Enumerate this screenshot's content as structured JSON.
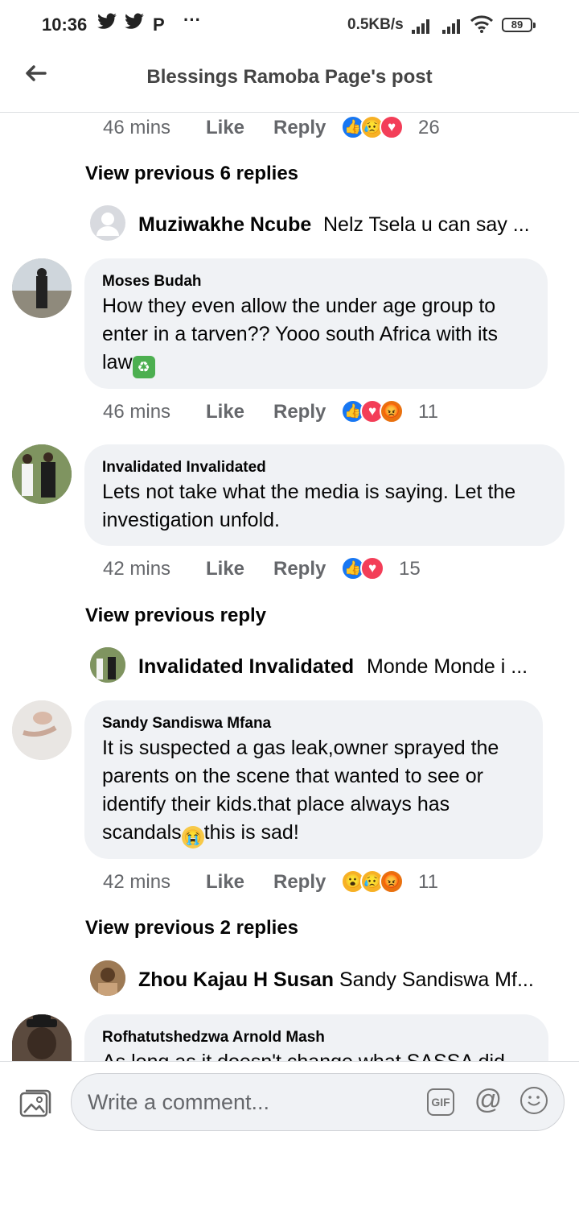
{
  "status_bar": {
    "time": "10:36",
    "icons": [
      "twitter-icon",
      "twitter-icon",
      "p-icon",
      "more-icon"
    ],
    "network_speed": "0.5KB/s",
    "battery": "89"
  },
  "header": {
    "title": "Blessings Ramoba Page's post",
    "back_icon": "arrow-left-icon"
  },
  "top_meta": {
    "time": "46 mins",
    "like": "Like",
    "reply": "Reply",
    "reactions": [
      "like",
      "sad",
      "love"
    ],
    "count": "26"
  },
  "threads": [
    {
      "view_previous": "View previous 6 replies",
      "mini_reply": {
        "name": "Muziwakhe Ncube",
        "text": "Nelz Tsela u can say ..."
      }
    },
    {
      "view_previous": "View previous reply",
      "mini_reply": {
        "name": "Invalidated Invalidated",
        "text": "Monde Monde i ..."
      }
    },
    {
      "view_previous": "View previous 2 replies",
      "mini_reply": {
        "name": "Zhou Kajau H Susan",
        "text": "Sandy Sandiswa Mf..."
      }
    }
  ],
  "comments": [
    {
      "author": "Moses Budah",
      "line1": "How they even allow the under age group to",
      "line2": "enter in a tarven?? Yooo south Africa with its",
      "line3": "law",
      "emoji": "trash-bin-emoji",
      "time": "46 mins",
      "like": "Like",
      "reply": "Reply",
      "reactions": [
        "like",
        "love",
        "angry"
      ],
      "count": "11"
    },
    {
      "author": "Invalidated Invalidated",
      "line1": "Lets not take what the media is saying. Let the",
      "line2": "investigation unfold.",
      "time": "42 mins",
      "like": "Like",
      "reply": "Reply",
      "reactions": [
        "like",
        "love"
      ],
      "count": "15"
    },
    {
      "author": "Sandy Sandiswa Mfana",
      "line1": "It is suspected a gas leak,owner sprayed the",
      "line2": "parents on the scene that wanted to see or",
      "line3": "identify their kids.that place always has",
      "line4a": "scandals",
      "emoji": "crying-face-emoji",
      "line4b": "this is sad!",
      "time": "42 mins",
      "like": "Like",
      "reply": "Reply",
      "reactions": [
        "wow",
        "sad",
        "angry"
      ],
      "count": "11"
    },
    {
      "author": "Rofhatutshedzwa Arnold Mash",
      "line1": "As long as it doesn't change what SASSA did"
    }
  ],
  "composer": {
    "placeholder": "Write a comment...",
    "gif_label": "GIF",
    "photo_icon": "photo-icon",
    "mention_icon": "at-icon",
    "emoji_icon": "smiley-icon"
  }
}
